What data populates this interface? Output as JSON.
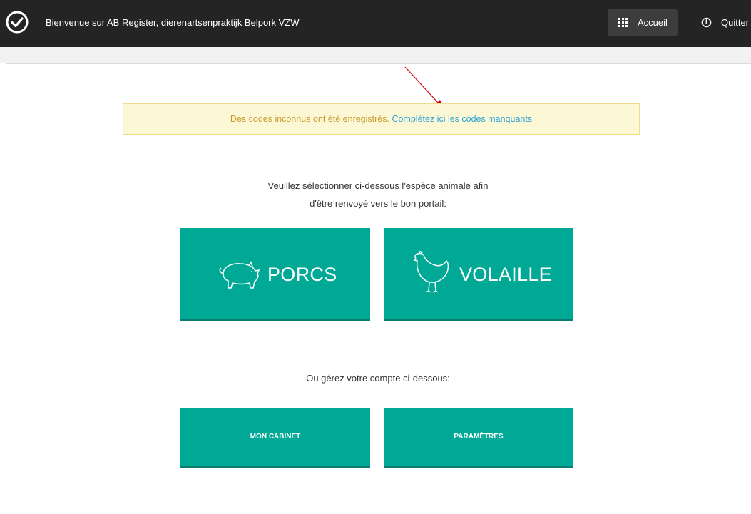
{
  "header": {
    "welcome_text": "Bienvenue sur AB Register, dierenartsenpraktijk Belpork VZW",
    "accueil_label": "Accueil",
    "quitter_label": "Quitter"
  },
  "alert": {
    "message": "Des codes inconnus ont été enregistrés.",
    "link_text": "Complétez ici les codes manquants"
  },
  "species": {
    "prompt_line1": "Veuillez sélectionner ci-dessous l'espèce animale afin",
    "prompt_line2": "d'être renvoyé vers le bon portail:",
    "porcs_label": "PORCS",
    "volaille_label": "VOLAILLE"
  },
  "account": {
    "prompt": "Ou gérez votre compte ci-dessous:",
    "cabinet_label": "MON CABINET",
    "params_label": "PARAMÈTRES"
  },
  "colors": {
    "topbar": "#242424",
    "button_teal": "#00a896",
    "alert_bg": "#fcf8d6",
    "alert_text": "#c99a2e",
    "link": "#2ea3d6",
    "annotation_arrow": "#cc0000"
  },
  "icons": {
    "logo": "checkmark-circle-icon",
    "accueil": "grid-icon",
    "quitter": "power-icon",
    "porcs": "pig-icon",
    "volaille": "chicken-icon"
  }
}
